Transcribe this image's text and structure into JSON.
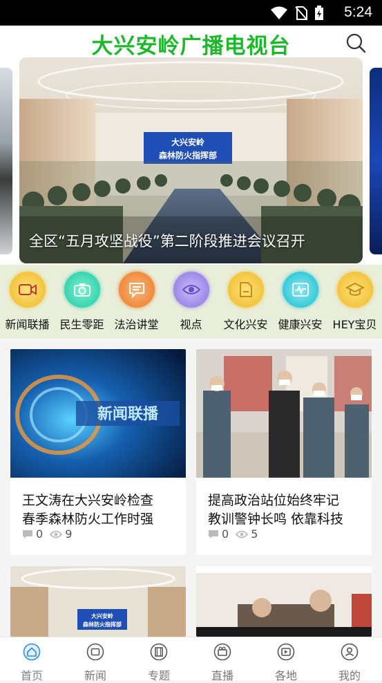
{
  "status": {
    "time": "5:24"
  },
  "header": {
    "title": "大兴安岭广播电视台"
  },
  "banner": {
    "caption": "全区“五月攻坚战役”第二阶段推进会议召开",
    "sign_line1": "大兴安岭",
    "sign_line2": "森林防火指挥部"
  },
  "categories": [
    {
      "label": "新闻联播",
      "icon": "video-camera-icon",
      "color": "#f3c43f"
    },
    {
      "label": "民生零距",
      "icon": "camera-icon",
      "color": "#38d4b0"
    },
    {
      "label": "法治讲堂",
      "icon": "chat-icon",
      "color": "#f08a3c"
    },
    {
      "label": "视点",
      "icon": "eye-icon",
      "color": "#9b88e8"
    },
    {
      "label": "文化兴安",
      "icon": "folder-icon",
      "color": "#f3c43f"
    },
    {
      "label": "健康兴安",
      "icon": "pulse-icon",
      "color": "#38c9d8"
    },
    {
      "label": "HEY宝贝",
      "icon": "graduation-cap-icon",
      "color": "#f3c43f"
    }
  ],
  "cards": [
    {
      "title_line1": "王文涛在大兴安岭检查",
      "title_line2": "春季森林防火工作时强",
      "comments": "0",
      "views": "9"
    },
    {
      "title_line1": "提高政治站位始终牢记",
      "title_line2": "教训警钟长鸣 依靠科技",
      "comments": "0",
      "views": "5"
    },
    {
      "sign_line1": "大兴安岭",
      "sign_line2": "森林防火指挥部"
    },
    {}
  ],
  "thumb_text": {
    "news_logo": "新闻联播"
  },
  "tabs": [
    {
      "label": "首页",
      "icon": "home-icon",
      "active": true
    },
    {
      "label": "新闻",
      "icon": "tv-icon"
    },
    {
      "label": "专题",
      "icon": "film-icon"
    },
    {
      "label": "直播",
      "icon": "live-camera-icon"
    },
    {
      "label": "各地",
      "icon": "location-video-icon"
    },
    {
      "label": "我的",
      "icon": "user-icon"
    }
  ]
}
